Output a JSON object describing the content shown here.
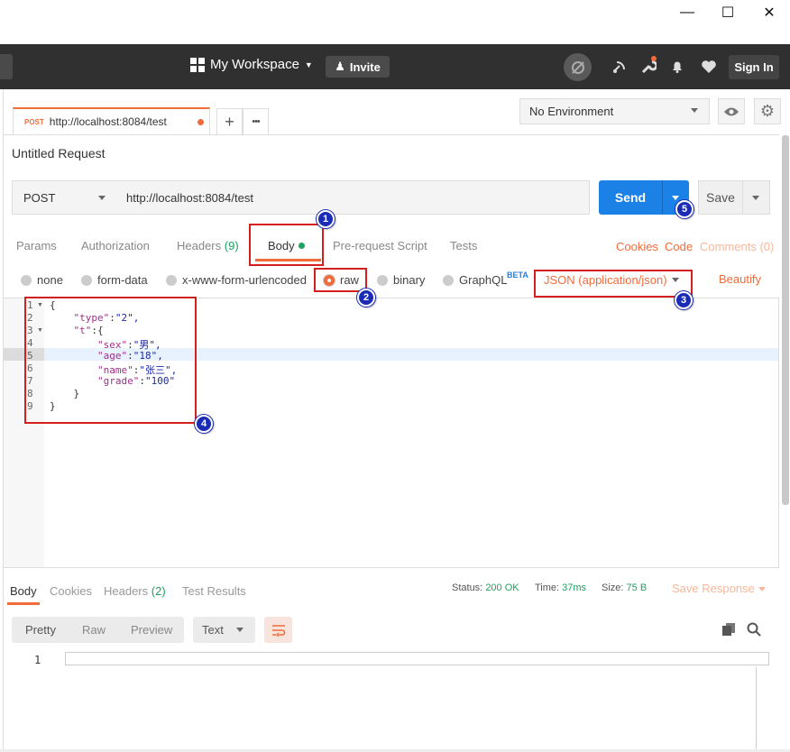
{
  "window": {
    "minimize": "—",
    "maximize": "☐",
    "close": "✕"
  },
  "header": {
    "workspace": "My Workspace",
    "invite": "Invite",
    "sign_in": "Sign In"
  },
  "tabs": {
    "active": {
      "method": "POST",
      "url": "http://localhost:8084/test"
    },
    "add": "+",
    "more": "•••"
  },
  "environment": {
    "selected": "No Environment"
  },
  "request": {
    "title": "Untitled Request",
    "method": "POST",
    "url": "http://localhost:8084/test",
    "send": "Send",
    "save": "Save"
  },
  "request_tabs": {
    "params": "Params",
    "authorization": "Authorization",
    "headers": "Headers",
    "headers_count": "(9)",
    "body": "Body",
    "prerequest": "Pre-request Script",
    "tests": "Tests",
    "cookies": "Cookies",
    "code": "Code",
    "comments": "Comments (0)"
  },
  "body_types": {
    "none": "none",
    "form_data": "form-data",
    "urlencoded": "x-www-form-urlencoded",
    "raw": "raw",
    "binary": "binary",
    "graphql": "GraphQL",
    "beta": "BETA",
    "content_type": "JSON (application/json)",
    "beautify": "Beautify"
  },
  "editor": {
    "line_numbers": [
      "1",
      "2",
      "3",
      "4",
      "5",
      "6",
      "7",
      "8",
      "9"
    ],
    "lines": [
      {
        "indent": "",
        "key": "",
        "sep": "",
        "val": "{"
      },
      {
        "indent": "    ",
        "key": "\"type\"",
        "sep": ":",
        "val": "\"2\","
      },
      {
        "indent": "    ",
        "key": "\"t\"",
        "sep": ":",
        "val": "{"
      },
      {
        "indent": "        ",
        "key": "\"sex\"",
        "sep": ":",
        "val": "\"男\","
      },
      {
        "indent": "        ",
        "key": "\"age\"",
        "sep": ":",
        "val": "\"18\","
      },
      {
        "indent": "        ",
        "key": "\"name\"",
        "sep": ":",
        "val": "\"张三\","
      },
      {
        "indent": "        ",
        "key": "\"grade\"",
        "sep": ":",
        "val": "\"100\""
      },
      {
        "indent": "    ",
        "key": "",
        "sep": "",
        "val": "}"
      },
      {
        "indent": "",
        "key": "",
        "sep": "",
        "val": "}"
      }
    ]
  },
  "response": {
    "tabs": {
      "body": "Body",
      "cookies": "Cookies",
      "headers": "Headers",
      "headers_count": "(2)",
      "test_results": "Test Results"
    },
    "status_label": "Status:",
    "status": "200 OK",
    "time_label": "Time:",
    "time": "37ms",
    "size_label": "Size:",
    "size": "75 B",
    "save_response": "Save Response",
    "views": {
      "pretty": "Pretty",
      "raw": "Raw",
      "preview": "Preview"
    },
    "format": "Text",
    "line_number": "1"
  },
  "annotations": [
    "1",
    "2",
    "3",
    "4",
    "5"
  ]
}
